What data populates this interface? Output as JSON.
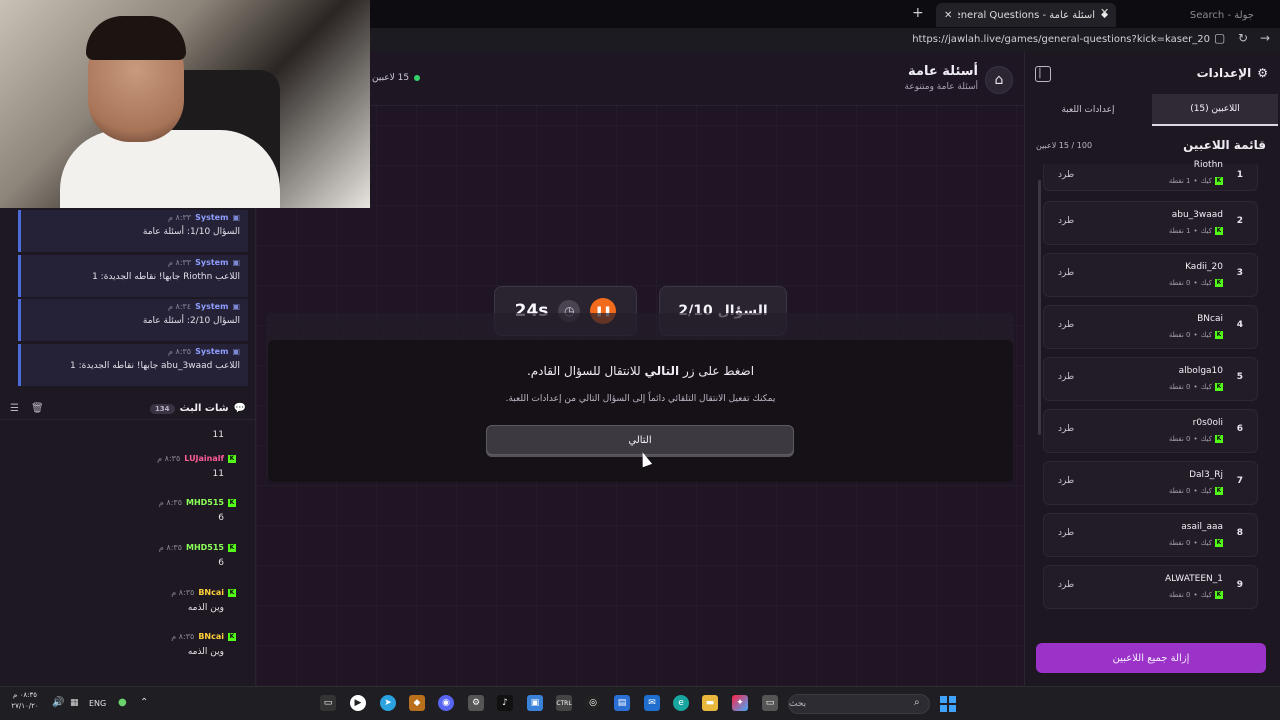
{
  "browser": {
    "active_tab_title": "أسئلة عامة - General Questions | جـ",
    "inactive_tab_title": "جولة - Search",
    "url": "https://jawlah.live/games/general-questions?kick=kaser_20"
  },
  "chat": {
    "system_messages": [
      {
        "sender": "System",
        "time": "٨:٣٣ م",
        "text": "السؤال 1/10: أسئلة عامة"
      },
      {
        "sender": "System",
        "time": "٨:٣٣ م",
        "text": "اللاعب Riothn جابها! نقاطه الجديدة: 1"
      },
      {
        "sender": "System",
        "time": "٨:٣٤ م",
        "text": "السؤال 2/10: أسئلة عامة"
      },
      {
        "sender": "System",
        "time": "٨:٣٥ م",
        "text": "اللاعب abu_3waad جابها! نقاطه الجديدة: 1"
      }
    ],
    "title": "شات البث",
    "count": "134",
    "messages": [
      {
        "user": "",
        "time": "",
        "text": "11",
        "color": "#ffffff"
      },
      {
        "user": "LUJainalf",
        "time": "٨:٣٥ م",
        "text": "11",
        "color": "#ff5c9a"
      },
      {
        "user": "MHD515",
        "time": "٨:٣٥ م",
        "text": "6",
        "color": "#8cff5a"
      },
      {
        "user": "MHD515",
        "time": "٨:٣٥ م",
        "text": "6",
        "color": "#8cff5a"
      },
      {
        "user": "BNcai",
        "time": "٨:٣٥ م",
        "text": "وين الذمه",
        "color": "#ffcf3a"
      },
      {
        "user": "BNcai",
        "time": "٨:٣٥ م",
        "text": "وين الذمه",
        "color": "#ffcf3a"
      }
    ]
  },
  "game": {
    "title": "أسئلة عامة",
    "subtitle": "أسئلة عامة ومتنوعة",
    "players_online": "15 لاعبين",
    "timer": "24s",
    "question_label": "السؤال 2/10",
    "modal_prefix": "اضغط على زر ",
    "modal_bold": "التالي",
    "modal_suffix": " للانتقال للسؤال القادم.",
    "modal_sub": "يمكنك تفعيل الانتقال التلقائي دائماً إلى السؤال التالي من إعدادات اللعبة.",
    "next_button": "التالي"
  },
  "settings": {
    "title": "الإعدادات",
    "tab_players": "اللاعبين (15)",
    "tab_game": "إعدادات اللعبة",
    "list_title": "قائمة اللاعبين",
    "list_count": "100 / 15 لاعبين",
    "platform": "كيك",
    "kick_label": "طرد",
    "players": [
      {
        "rank": "1",
        "name": "Riothn",
        "points": "1 نقطة"
      },
      {
        "rank": "2",
        "name": "abu_3waad",
        "points": "1 نقطة"
      },
      {
        "rank": "3",
        "name": "Kadii_20",
        "points": "0 نقطة"
      },
      {
        "rank": "4",
        "name": "BNcai",
        "points": "0 نقطة"
      },
      {
        "rank": "5",
        "name": "albolga10",
        "points": "0 نقطة"
      },
      {
        "rank": "6",
        "name": "r0s0oli",
        "points": "0 نقطة"
      },
      {
        "rank": "7",
        "name": "Dal3_Rj",
        "points": "0 نقطة"
      },
      {
        "rank": "8",
        "name": "asail_aaa",
        "points": "0 نقطة"
      },
      {
        "rank": "9",
        "name": "ALWATEEN_1",
        "points": "0 نقطة"
      }
    ],
    "remove_all": "إزالة جميع اللاعبين"
  },
  "taskbar": {
    "time": "٠٨:٣٥ م",
    "date": "٢٧/١٠/٢٠",
    "lang": "ENG",
    "search": "بحث"
  },
  "colors": {
    "accent_purple": "#9b33c8",
    "pause_orange": "#f26b1c",
    "kick_green": "#53fc18",
    "system_blue": "#4d6bd8"
  }
}
